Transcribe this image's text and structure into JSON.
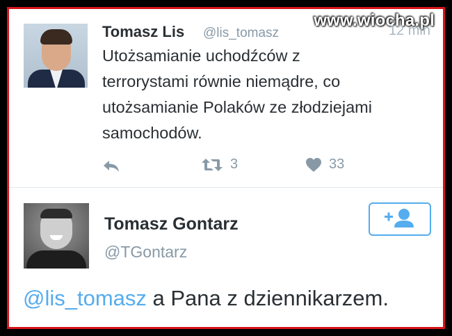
{
  "watermark": "www.wiocha.pl",
  "tweet1": {
    "author_name": "Tomasz Lis",
    "author_handle": "@lis_tomasz",
    "time": "12 min",
    "text": "Utożsamianie uchodźców z\nterrorystami równie niemądre, co\nutożsamianie Polaków ze złodziejami\nsamochodów.",
    "retweet_count": "3",
    "like_count": "33",
    "icons": [
      "reply-icon",
      "retweet-icon",
      "heart-icon"
    ]
  },
  "tweet2": {
    "author_name": "Tomasz Gontarz",
    "author_handle": "@TGontarz",
    "mention": "@lis_tomasz",
    "text_rest": " a Pana z dziennikarzem.",
    "follow_icon": "add-user-icon"
  },
  "colors": {
    "frame": "#d4151b",
    "link": "#55acee",
    "text": "#292f33",
    "muted": "#8899a6"
  }
}
